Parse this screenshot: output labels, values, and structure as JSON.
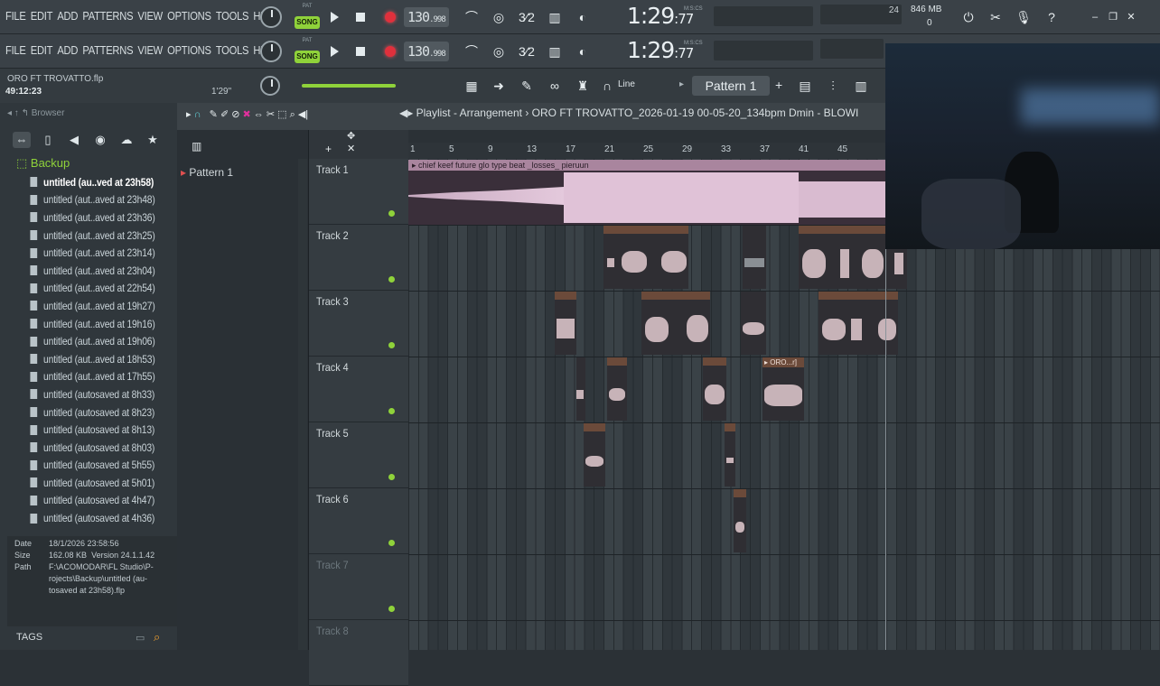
{
  "menu": [
    "FILE",
    "EDIT",
    "ADD",
    "PATTERNS",
    "VIEW",
    "OPTIONS",
    "TOOLS",
    "HELP"
  ],
  "transport": {
    "song": "SONG",
    "pat": "PAT",
    "tempo": "130",
    "tempo_dec": ".998",
    "time": "1:29",
    "time_ms": "77",
    "time_unit": "M:S:CS"
  },
  "monitor": {
    "cpu": "24",
    "mem": "846 MB",
    "poly": "0"
  },
  "project": {
    "title": "ORO FT TROVATTO.flp",
    "time": "49:12:23",
    "len": "1'29\""
  },
  "toolbar": {
    "snap": "Line",
    "pattern": "Pattern 1"
  },
  "browser": {
    "title": "Browser",
    "folder": "Backup",
    "files": [
      "untitled (au..ved at 23h58)",
      "untitled (aut..aved at 23h48)",
      "untitled (aut..aved at 23h36)",
      "untitled (aut..aved at 23h25)",
      "untitled (aut..aved at 23h14)",
      "untitled (aut..aved at 23h04)",
      "untitled (aut..aved at 22h54)",
      "untitled (aut..aved at 19h27)",
      "untitled (aut..aved at 19h16)",
      "untitled (aut..aved at 19h06)",
      "untitled (aut..aved at 18h53)",
      "untitled (aut..aved at 17h55)",
      "untitled (autosaved at 8h33)",
      "untitled (autosaved at 8h23)",
      "untitled (autosaved at 8h13)",
      "untitled (autosaved at 8h03)",
      "untitled (autosaved at 5h55)",
      "untitled (autosaved at 5h01)",
      "untitled (autosaved at 4h47)",
      "untitled (autosaved at 4h36)"
    ]
  },
  "fileinfo": {
    "date_k": "Date",
    "date_v": "18/1/2026 23:58:56",
    "size_k": "Size",
    "size_v": "162.08 KB",
    "ver": "Version 24.1.1.42",
    "path_k": "Path",
    "path_v1": "F:\\ACOMODAR\\FL Studio\\P-",
    "path_v2": "rojects\\Backup\\untitled (au-",
    "path_v3": "tosaved at 23h58).flp"
  },
  "tags": "TAGS",
  "playlist": {
    "title": "Playlist - Arrangement",
    "crumb": "ORO FT TROVATTO_2026-01-19 00-05-20_134bpm Dmin - BLOWI",
    "pattern": "Pattern 1"
  },
  "ruler": [
    "1",
    "5",
    "9",
    "13",
    "17",
    "21",
    "25",
    "29",
    "33",
    "37",
    "41",
    "45"
  ],
  "tracks": [
    "Track 1",
    "Track 2",
    "Track 3",
    "Track 4",
    "Track 5",
    "Track 6",
    "Track 7",
    "Track 8"
  ],
  "clips": {
    "t1": "chief keef future glo type beat _losses_ pieruun",
    "t4": "ORO...r]"
  }
}
